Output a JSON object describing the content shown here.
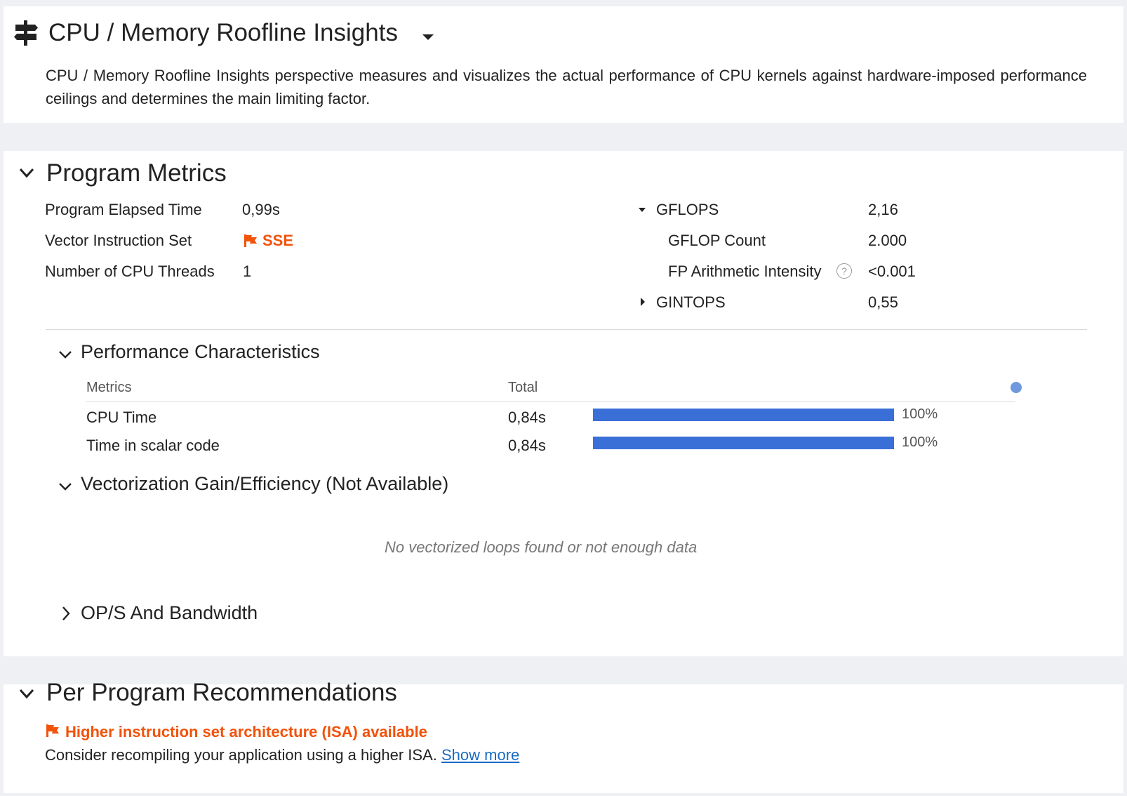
{
  "header": {
    "title": "CPU / Memory Roofline Insights",
    "description": "CPU / Memory Roofline Insights perspective measures and visualizes the actual performance of CPU kernels against hardware-imposed performance ceilings and determines the main limiting factor."
  },
  "program_metrics": {
    "title": "Program Metrics",
    "left": [
      {
        "label": "Program Elapsed Time",
        "value": "0,99s"
      },
      {
        "label": "Vector Instruction Set",
        "value": "SSE"
      },
      {
        "label": "Number of CPU Threads",
        "value": "1"
      }
    ],
    "right": {
      "gflops": {
        "label": "GFLOPS",
        "value": "2,16"
      },
      "gflop_count": {
        "label": "GFLOP Count",
        "value": "2.000"
      },
      "fp_intensity": {
        "label": "FP Arithmetic Intensity",
        "value": "<0.001",
        "help": "?"
      },
      "gintops": {
        "label": "GINTOPS",
        "value": "0,55"
      }
    },
    "perf": {
      "title": "Performance Characteristics",
      "col_metrics": "Metrics",
      "col_total": "Total",
      "rows": [
        {
          "label": "CPU Time",
          "value": "0,84s",
          "percent_text": "100%",
          "fraction": 1.0
        },
        {
          "label": "Time in scalar code",
          "value": "0,84s",
          "percent_text": "100%",
          "fraction": 1.0
        }
      ]
    },
    "vectorization": {
      "title": "Vectorization Gain/Efficiency (Not Available)",
      "empty_message": "No vectorized loops found or not enough data"
    },
    "ops_bandwidth": {
      "title": "OP/S And Bandwidth"
    }
  },
  "recommendations": {
    "title": "Per Program Recommendations",
    "warning": "Higher instruction set architecture (ISA) available",
    "text": "Consider recompiling your application using a higher ISA.",
    "link": "Show more"
  },
  "colors": {
    "accent": "#3a6fd8",
    "warning": "#f2520a",
    "link": "#1a6bc5"
  },
  "icons": [
    "signpost-icon",
    "chevron-down-icon",
    "chevron-right-icon",
    "flag-icon",
    "help-icon",
    "triangle-down-icon",
    "triangle-right-icon"
  ]
}
